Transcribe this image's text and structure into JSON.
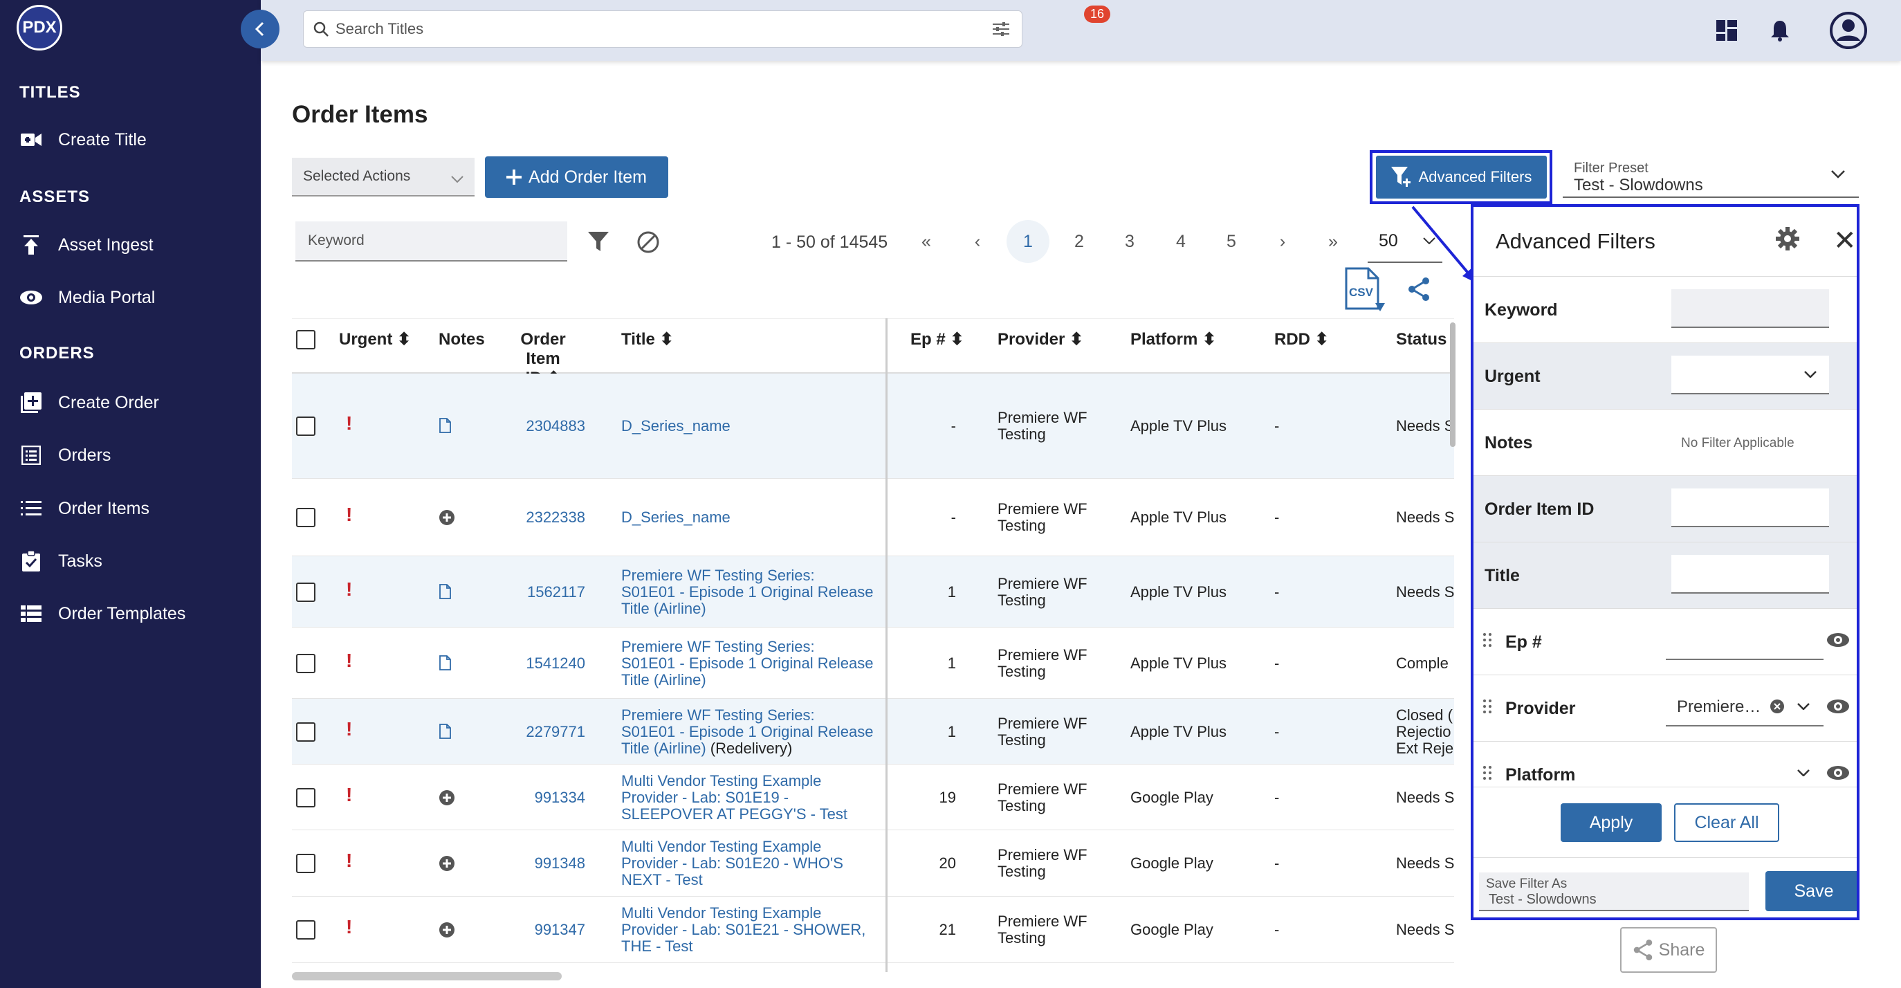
{
  "sidebar": {
    "logo": "PDX",
    "sections": {
      "titles": "TITLES",
      "assets": "ASSETS",
      "orders": "ORDERS"
    },
    "items": {
      "create_title": "Create Title",
      "asset_ingest": "Asset Ingest",
      "media_portal": "Media Portal",
      "create_order": "Create Order",
      "orders": "Orders",
      "order_items": "Order Items",
      "tasks": "Tasks",
      "order_templates": "Order Templates"
    }
  },
  "topbar": {
    "search_placeholder": "Search Titles",
    "notification_count": "16"
  },
  "page": {
    "title": "Order Items",
    "selected_actions": "Selected Actions",
    "add_order_item": "Add Order Item",
    "advanced_filters": "Advanced Filters",
    "filter_preset_label": "Filter Preset",
    "filter_preset_value": "Test - Slowdowns",
    "keyword_placeholder": "Keyword",
    "pager_range": "1 - 50 of 14545",
    "pages": [
      "1",
      "2",
      "3",
      "4",
      "5"
    ],
    "per_page": "50"
  },
  "table": {
    "columns": {
      "urgent": "Urgent",
      "notes": "Notes",
      "order_item_id_1": "Order Item",
      "order_item_id_2": "ID",
      "title": "Title",
      "ep": "Ep #",
      "provider": "Provider",
      "platform": "Platform",
      "rdd": "RDD",
      "status": "Status"
    },
    "rows": [
      {
        "id": "2304883",
        "title_lines": [
          "D_Series_name"
        ],
        "suffix": "",
        "ep": "-",
        "provider_lines": [
          "Premiere WF",
          "Testing"
        ],
        "platform": "Apple TV Plus",
        "rdd": "-",
        "status_lines": [
          "Needs S"
        ]
      },
      {
        "id": "2322338",
        "title_lines": [
          "D_Series_name"
        ],
        "suffix": "",
        "ep": "-",
        "provider_lines": [
          "Premiere WF",
          "Testing"
        ],
        "platform": "Apple TV Plus",
        "rdd": "-",
        "status_lines": [
          "Needs S"
        ]
      },
      {
        "id": "1562117",
        "title_lines": [
          "Premiere WF Testing Series:",
          "S01E01 - Episode 1 Original Release",
          "Title (Airline)"
        ],
        "suffix": "",
        "ep": "1",
        "provider_lines": [
          "Premiere WF",
          "Testing"
        ],
        "platform": "Apple TV Plus",
        "rdd": "-",
        "status_lines": [
          "Needs S"
        ]
      },
      {
        "id": "1541240",
        "title_lines": [
          "Premiere WF Testing Series:",
          "S01E01 - Episode 1 Original Release",
          "Title (Airline)"
        ],
        "suffix": "",
        "ep": "1",
        "provider_lines": [
          "Premiere WF",
          "Testing"
        ],
        "platform": "Apple TV Plus",
        "rdd": "-",
        "status_lines": [
          "Comple"
        ]
      },
      {
        "id": "2279771",
        "title_lines": [
          "Premiere WF Testing Series:",
          "S01E01 - Episode 1 Original Release",
          "Title (Airline)"
        ],
        "suffix": "(Redelivery)",
        "ep": "1",
        "provider_lines": [
          "Premiere WF",
          "Testing"
        ],
        "platform": "Apple TV Plus",
        "rdd": "-",
        "status_lines": [
          "Closed (",
          "Rejectio",
          "Ext Reje"
        ]
      },
      {
        "id": "991334",
        "title_lines": [
          "Multi Vendor Testing Example",
          "Provider - Lab: S01E19 -",
          "SLEEPOVER AT PEGGY'S - Test"
        ],
        "suffix": "",
        "ep": "19",
        "provider_lines": [
          "Premiere WF",
          "Testing"
        ],
        "platform": "Google Play",
        "rdd": "-",
        "status_lines": [
          "Needs S"
        ]
      },
      {
        "id": "991348",
        "title_lines": [
          "Multi Vendor Testing Example",
          "Provider - Lab: S01E20 - WHO'S",
          "NEXT - Test"
        ],
        "suffix": "",
        "ep": "20",
        "provider_lines": [
          "Premiere WF",
          "Testing"
        ],
        "platform": "Google Play",
        "rdd": "-",
        "status_lines": [
          "Needs S"
        ]
      },
      {
        "id": "991347",
        "title_lines": [
          "Multi Vendor Testing Example",
          "Provider - Lab: S01E21 - SHOWER,",
          "THE - Test"
        ],
        "suffix": "",
        "ep": "21",
        "provider_lines": [
          "Premiere WF",
          "Testing"
        ],
        "platform": "Google Play",
        "rdd": "-",
        "status_lines": [
          "Needs S"
        ]
      }
    ]
  },
  "advanced_filters_panel": {
    "title": "Advanced Filters",
    "keyword": "Keyword",
    "urgent": "Urgent",
    "notes": "Notes",
    "no_filter": "No Filter Applicable",
    "order_item_id": "Order Item ID",
    "title_label": "Title",
    "ep": "Ep #",
    "provider": "Provider",
    "provider_value": "Premiere…",
    "platform": "Platform",
    "apply": "Apply",
    "clear_all": "Clear All",
    "save_filter_as_label": "Save Filter As",
    "save_filter_as_value": "Test - Slowdowns",
    "save": "Save",
    "share": "Share"
  },
  "colors": {
    "sidebar_bg": "#1c1f4d",
    "accent": "#2f6aa8",
    "urgent": "#c9252c",
    "highlight": "#1d24d6"
  }
}
